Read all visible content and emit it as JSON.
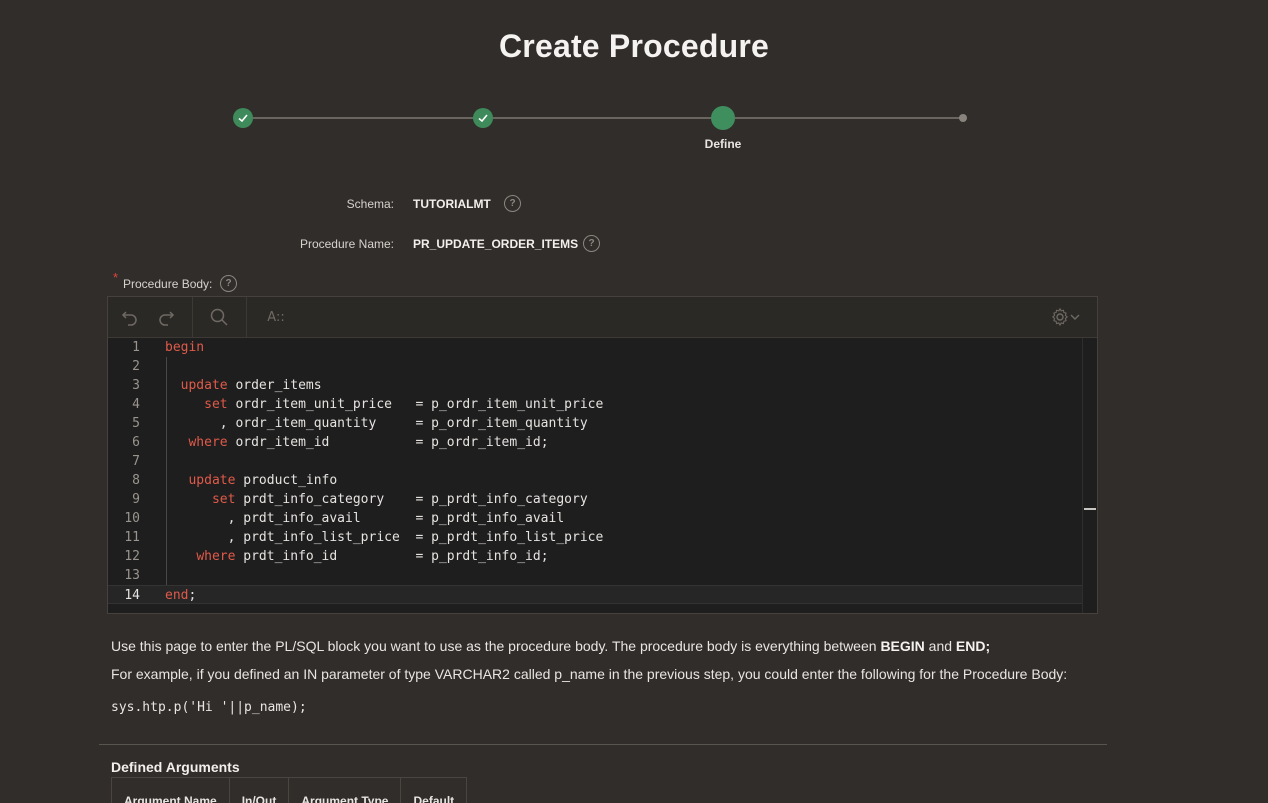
{
  "page": {
    "title": "Create Procedure"
  },
  "wizard": {
    "steps": [
      {
        "state": "done",
        "label": ""
      },
      {
        "state": "done",
        "label": ""
      },
      {
        "state": "current",
        "label": "Define"
      },
      {
        "state": "future",
        "label": ""
      }
    ]
  },
  "form": {
    "schema_label": "Schema:",
    "schema_value": "TUTORIALMT",
    "procedure_name_label": "Procedure Name:",
    "procedure_name_value": "PR_UPDATE_ORDER_ITEMS",
    "procedure_body_label": "Procedure Body:",
    "required_marker": "*"
  },
  "editor": {
    "toolbar": {
      "undo_icon": "undo-icon",
      "redo_icon": "redo-icon",
      "search_icon": "search-icon",
      "font_size_label": "A::",
      "settings_icon": "gear-icon"
    },
    "lines": [
      {
        "n": "1",
        "code": "begin"
      },
      {
        "n": "2",
        "code": ""
      },
      {
        "n": "3",
        "code": "  update order_items"
      },
      {
        "n": "4",
        "code": "     set ordr_item_unit_price   = p_ordr_item_unit_price"
      },
      {
        "n": "5",
        "code": "       , ordr_item_quantity     = p_ordr_item_quantity"
      },
      {
        "n": "6",
        "code": "   where ordr_item_id           = p_ordr_item_id;"
      },
      {
        "n": "7",
        "code": ""
      },
      {
        "n": "8",
        "code": "   update product_info"
      },
      {
        "n": "9",
        "code": "      set prdt_info_category    = p_prdt_info_category"
      },
      {
        "n": "10",
        "code": "        , prdt_info_avail       = p_prdt_info_avail"
      },
      {
        "n": "11",
        "code": "        , prdt_info_list_price  = p_prdt_info_list_price"
      },
      {
        "n": "12",
        "code": "    where prdt_info_id          = p_prdt_info_id;"
      },
      {
        "n": "13",
        "code": ""
      },
      {
        "n": "14",
        "code": "end;"
      }
    ],
    "active_line": 14
  },
  "help": {
    "line1_prefix": "Use this page to enter the PL/SQL block you want to use as the procedure body. The procedure body is everything between ",
    "line1_begin": "BEGIN",
    "line1_and": " and ",
    "line1_end": "END;",
    "line2": "For example, if you defined an IN parameter of type VARCHAR2 called p_name in the previous step, you could enter the following for the Procedure Body:",
    "example": "sys.htp.p('Hi '||p_name);"
  },
  "arguments": {
    "title": "Defined Arguments",
    "columns": [
      "Argument Name",
      "In/Out",
      "Argument Type",
      "Default"
    ]
  },
  "colors": {
    "background": "#312d2a",
    "step_green": "#3e8a5b",
    "keyword_red": "#e05a4a",
    "editor_bg": "#1e1e1e"
  }
}
